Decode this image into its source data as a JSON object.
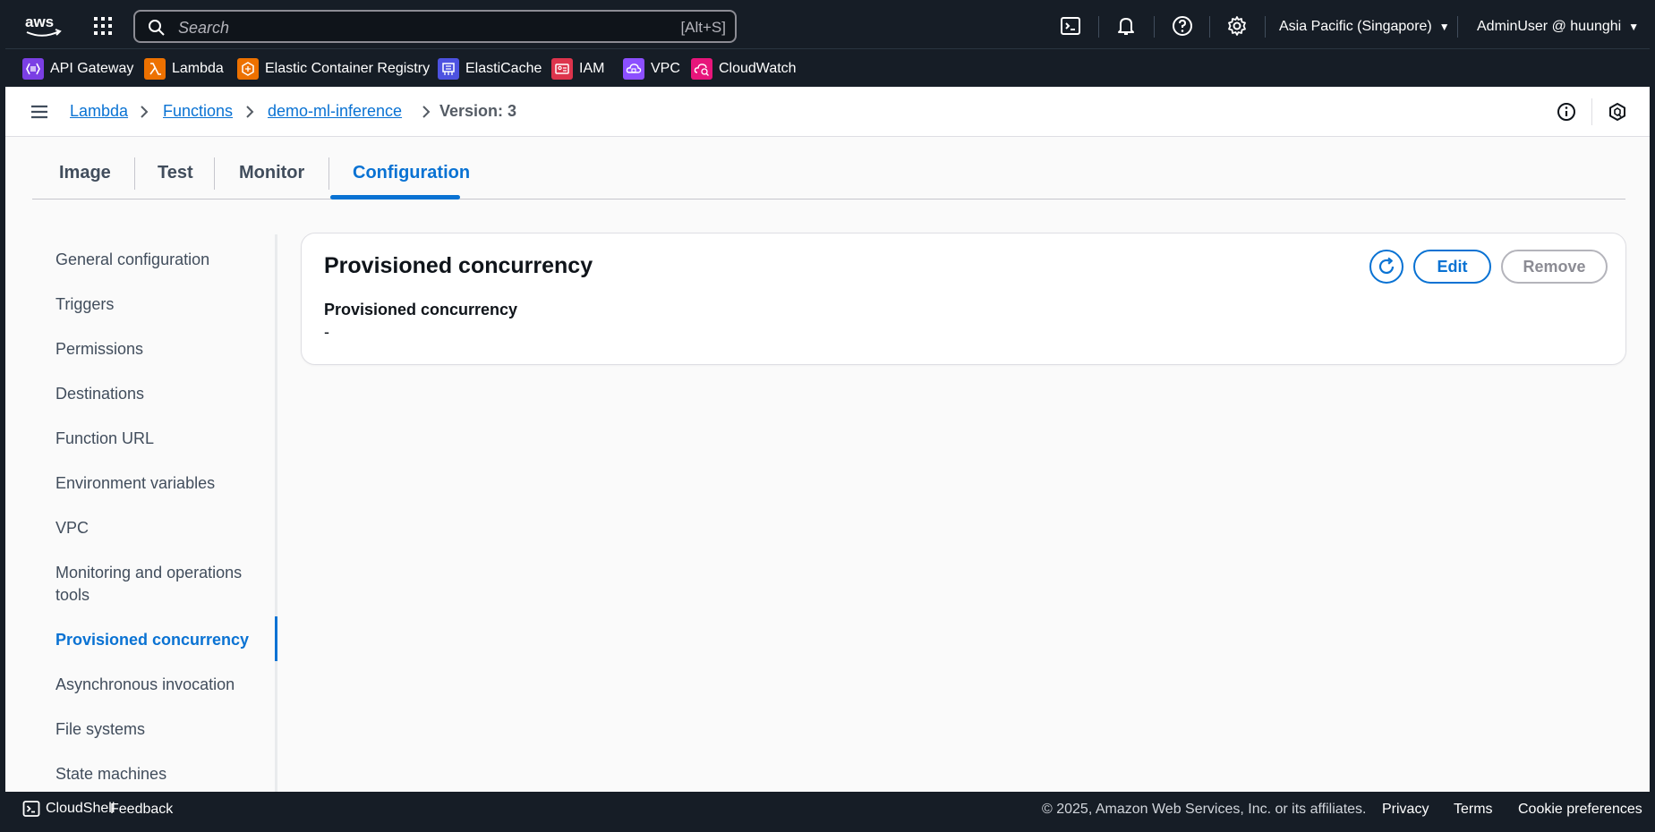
{
  "topnav": {
    "search_placeholder": "Search",
    "search_shortcut": "[Alt+S]",
    "region": "Asia Pacific (Singapore)",
    "account": "AdminUser @ huunghi"
  },
  "favorites": [
    {
      "label": "API Gateway",
      "icon": "api-gateway-icon",
      "color": "#7b3fe4"
    },
    {
      "label": "Lambda",
      "icon": "lambda-icon",
      "color": "#ed7100"
    },
    {
      "label": "Elastic Container Registry",
      "icon": "ecr-icon",
      "color": "#ed7100"
    },
    {
      "label": "ElastiCache",
      "icon": "elasticache-icon",
      "color": "#4d52e0"
    },
    {
      "label": "IAM",
      "icon": "iam-icon",
      "color": "#dd344c"
    },
    {
      "label": "VPC",
      "icon": "vpc-icon",
      "color": "#8c4fff"
    },
    {
      "label": "CloudWatch",
      "icon": "cloudwatch-icon",
      "color": "#e7157b"
    }
  ],
  "breadcrumb": {
    "items": [
      "Lambda",
      "Functions",
      "demo-ml-inference"
    ],
    "current": "Version: 3"
  },
  "tabs": [
    {
      "label": "Image",
      "active": false
    },
    {
      "label": "Test",
      "active": false
    },
    {
      "label": "Monitor",
      "active": false
    },
    {
      "label": "Configuration",
      "active": true
    }
  ],
  "sidenav": {
    "items": [
      "General configuration",
      "Triggers",
      "Permissions",
      "Destinations",
      "Function URL",
      "Environment variables",
      "VPC",
      "Monitoring and operations tools",
      "Provisioned concurrency",
      "Asynchronous invocation",
      "File systems",
      "State machines"
    ],
    "active": "Provisioned concurrency"
  },
  "panel": {
    "title": "Provisioned concurrency",
    "field_label": "Provisioned concurrency",
    "field_value": "-",
    "edit_label": "Edit",
    "remove_label": "Remove"
  },
  "footer": {
    "cloudshell": "CloudShell",
    "feedback": "Feedback",
    "copyright": "© 2025, Amazon Web Services, Inc. or its affiliates.",
    "privacy": "Privacy",
    "terms": "Terms",
    "cookies": "Cookie preferences"
  },
  "colors": {
    "accent": "#0972d3",
    "nav_bg": "#161d26"
  }
}
